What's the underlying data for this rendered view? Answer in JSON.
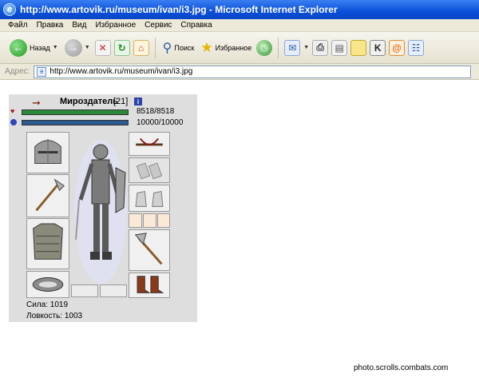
{
  "window": {
    "title": "http://www.artovik.ru/museum/ivan/i3.jpg - Microsoft Internet Explorer"
  },
  "menu": {
    "items": [
      "Файл",
      "Правка",
      "Вид",
      "Избранное",
      "Сервис",
      "Справка"
    ]
  },
  "toolbar": {
    "back_label": "Назад",
    "search_label": "Поиск",
    "favorites_label": "Избранное"
  },
  "address": {
    "label": "Адрес:",
    "url": "http://www.artovik.ru/museum/ivan/i3.jpg"
  },
  "character": {
    "name": "Мироздатель",
    "level": "[21]",
    "hp": "8518/8518",
    "mana": "10000/10000",
    "hp_fill": 1.0,
    "mana_fill": 1.0,
    "strength": "Сила: 1019",
    "agility": "Ловкость: 1003"
  },
  "icons": {
    "back": "back-arrow-icon",
    "forward": "forward-arrow-icon",
    "stop": "stop-icon",
    "refresh": "refresh-icon",
    "home": "home-icon",
    "search": "magnifier-icon",
    "favorites": "star-icon",
    "history": "history-icon"
  },
  "watermark": "photo.scrolls.combats.com"
}
